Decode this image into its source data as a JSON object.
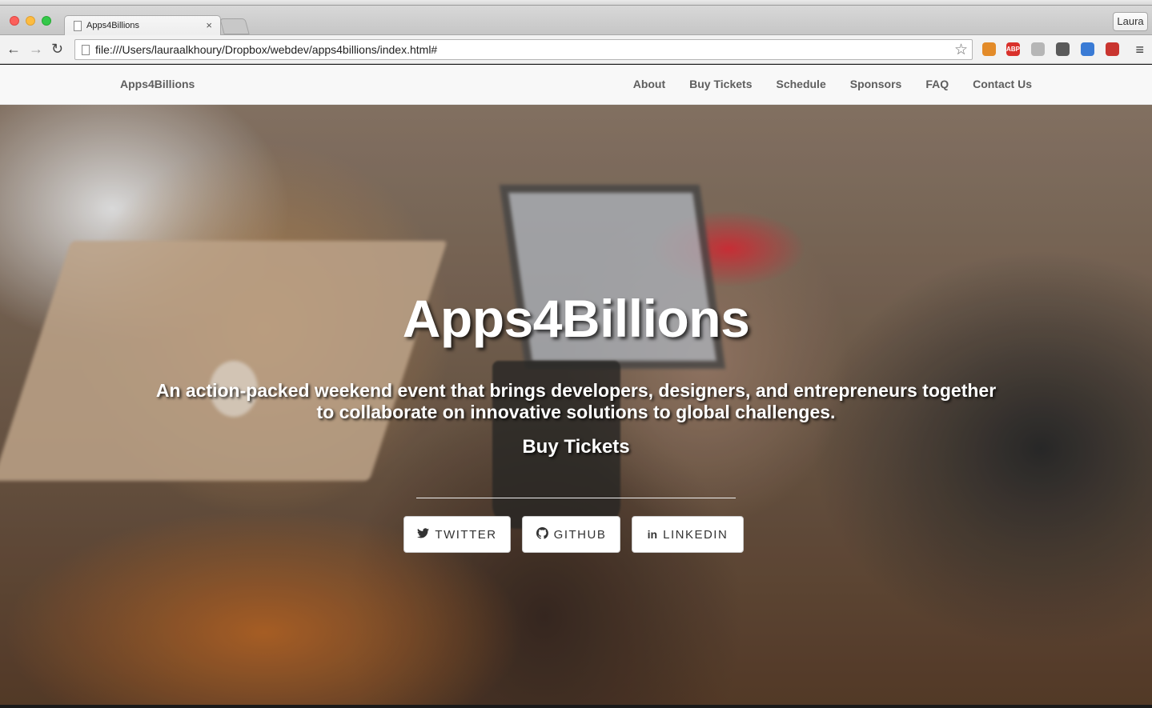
{
  "browser": {
    "tab_title": "Apps4Billions",
    "tab_close": "×",
    "profile_name": "Laura",
    "url": "file:///Users/lauraalkhoury/Dropbox/webdev/apps4billions/index.html#",
    "icons": {
      "back": "←",
      "forward": "→",
      "reload": "↻",
      "star": "☆",
      "menu": "≡"
    },
    "extensions": [
      {
        "name": "extension-icon",
        "color": "#e38b29",
        "text": ""
      },
      {
        "name": "adblock-icon",
        "color": "#d9312b",
        "text": "ABP"
      },
      {
        "name": "extension-icon",
        "color": "#b6b6b6",
        "text": ""
      },
      {
        "name": "extension-icon",
        "color": "#5a5a5a",
        "text": ""
      },
      {
        "name": "calendar-icon",
        "color": "#3a7bd5",
        "text": ""
      },
      {
        "name": "extension-icon",
        "color": "#c9352f",
        "text": ""
      }
    ]
  },
  "site": {
    "brand": "Apps4Billions",
    "nav": [
      "About",
      "Buy Tickets",
      "Schedule",
      "Sponsors",
      "FAQ",
      "Contact Us"
    ]
  },
  "hero": {
    "title": "Apps4Billions",
    "subtitle": "An action-packed weekend event that brings developers, designers, and entrepreneurs together to collaborate on innovative solutions to global challenges.",
    "cta": "Buy Tickets",
    "social": {
      "twitter": {
        "icon": "twitter-icon",
        "glyph": "🐦",
        "label": "TWITTER"
      },
      "github": {
        "icon": "github-icon",
        "glyph": "◎",
        "label": "GITHUB"
      },
      "linkedin": {
        "icon": "linkedin-icon",
        "glyph": "in",
        "label": "LINKEDIN"
      }
    }
  }
}
